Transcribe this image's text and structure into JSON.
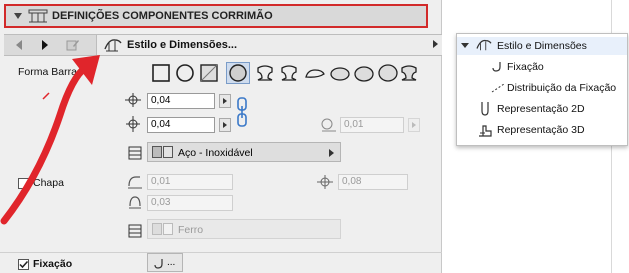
{
  "header": {
    "title": "DEFINIÇÕES COMPONENTES CORRIMÃO"
  },
  "navbar": {
    "selected": "Estilo e Dimensões..."
  },
  "shape": {
    "label": "Forma Barra"
  },
  "dims": {
    "width": "0,04",
    "height": "0,04",
    "offset": "0,01"
  },
  "material": {
    "name": "Aço - Inoxidável"
  },
  "plate": {
    "label": "Chapa",
    "v1": "0,01",
    "v2": "0,03",
    "offset": "0,08",
    "material": "Ferro"
  },
  "fixacao": {
    "label": "Fixação",
    "button": "..."
  },
  "menu": {
    "items": [
      {
        "label": "Estilo e Dimensões"
      },
      {
        "label": "Fixação"
      },
      {
        "label": "Distribuição da Fixação"
      },
      {
        "label": "Representação 2D"
      },
      {
        "label": "Representação 3D"
      }
    ]
  },
  "colors": {
    "highlight": "#d22a2a",
    "arrow": "#e0252b",
    "selection": "#e8f0fb"
  }
}
